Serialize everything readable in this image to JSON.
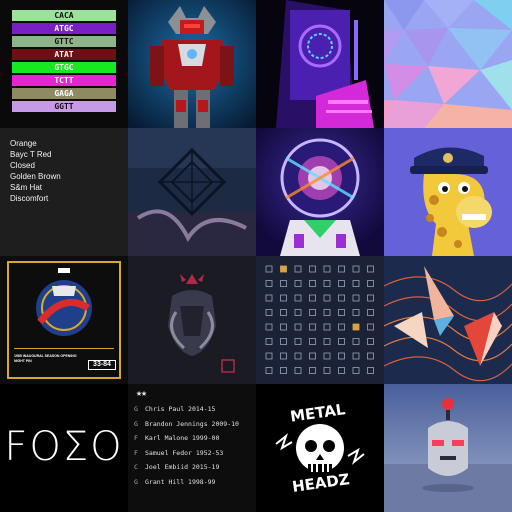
{
  "dna_strands": [
    {
      "label": "CACA",
      "color": "#9be39b"
    },
    {
      "label": "ATGC",
      "color": "#7a1fc4"
    },
    {
      "label": "GTTC",
      "color": "#8fb38a"
    },
    {
      "label": "ATAT",
      "color": "#6e0f14"
    },
    {
      "label": "GTGC",
      "color": "#18e81f"
    },
    {
      "label": "TCTT",
      "color": "#e624d6"
    },
    {
      "label": "GAGA",
      "color": "#8f8a63"
    },
    {
      "label": "GGTT",
      "color": "#c79ae8"
    }
  ],
  "traits": [
    "Orange",
    "Bayc T Red",
    "Closed",
    "Golden Brown",
    "S&m Hat",
    "Discomfort"
  ],
  "poster": {
    "footer_left": "1985 INAUGURAL SEASON OPENING NIGHT PIN",
    "badge": "33-84"
  },
  "foeo_text": "FOΣO",
  "stars_text": "★★",
  "players": [
    {
      "pos": "G",
      "name": "Chris Paul 2014-15"
    },
    {
      "pos": "G",
      "name": "Brandon Jennings 2009-10"
    },
    {
      "pos": "F",
      "name": "Karl Malone 1999-00"
    },
    {
      "pos": "F",
      "name": "Samuel Fedor 1952-53"
    },
    {
      "pos": "C",
      "name": "Joel Embiid 2015-19"
    },
    {
      "pos": "G",
      "name": "Grant Hill 1998-99"
    }
  ],
  "metal_headz": {
    "line1": "METAL",
    "line2": "HEADZ"
  },
  "colors": {
    "accent_pink": "#e624d6",
    "grid_orange": "#d9a441"
  }
}
